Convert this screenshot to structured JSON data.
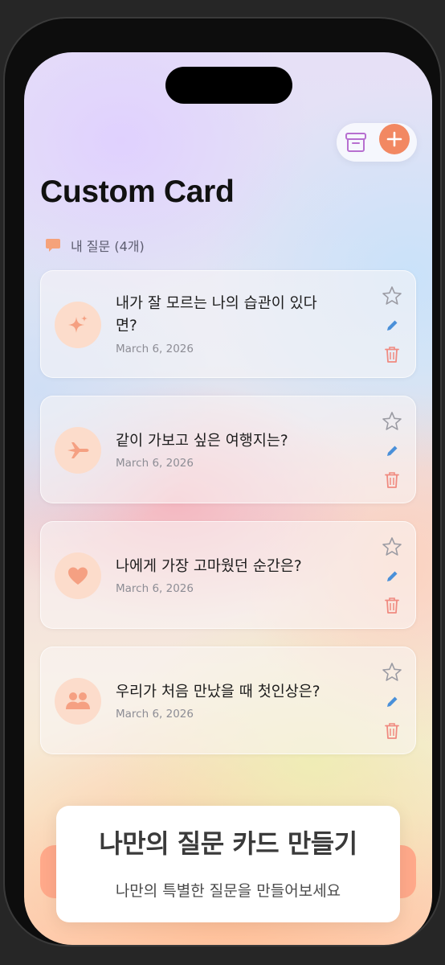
{
  "header": {
    "title": "Custom Card",
    "archive_icon": "archive-box-icon",
    "add_icon": "plus-icon",
    "accent_color": "#f28862"
  },
  "section": {
    "icon": "speech-bubble-icon",
    "label": "내 질문 (4개)"
  },
  "cards": [
    {
      "icon": "sparkles-icon",
      "question": "내가 잘 모르는 나의 습관이 있다면?",
      "date": "March 6, 2026",
      "favorite": false
    },
    {
      "icon": "airplane-icon",
      "question": "같이 가보고 싶은 여행지는?",
      "date": "March 6, 2026",
      "favorite": false
    },
    {
      "icon": "heart-icon",
      "question": "나에게 가장 고마웠던 순간은?",
      "date": "March 6, 2026",
      "favorite": false
    },
    {
      "icon": "people-icon",
      "question": "우리가 처음 만났을 때 첫인상은?",
      "date": "March 6, 2026",
      "favorite": false
    }
  ],
  "card_actions": {
    "favorite_icon": "star-icon",
    "edit_icon": "pencil-icon",
    "delete_icon": "trash-icon"
  },
  "tooltip": {
    "title": "나만의 질문 카드 만들기",
    "subtitle": "나만의 특별한 질문을 만들어보세요"
  }
}
